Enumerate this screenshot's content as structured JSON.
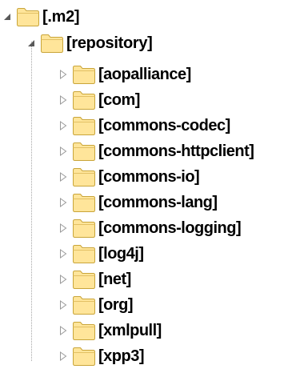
{
  "colors": {
    "folder_fill": "#ffe59a",
    "folder_stroke": "#c9a53a",
    "expanded_arrow": "#595959",
    "collapsed_arrow": "#9a9a9a"
  },
  "tree": {
    "root": {
      "label": "[.m2]",
      "icon": "folder-icon",
      "expanded": true
    },
    "repository": {
      "label": "[repository]",
      "icon": "folder-icon",
      "expanded": true
    },
    "children": [
      {
        "label": "[aopalliance]",
        "expanded": false
      },
      {
        "label": "[com]",
        "expanded": false
      },
      {
        "label": "[commons-codec]",
        "expanded": false
      },
      {
        "label": "[commons-httpclient]",
        "expanded": false
      },
      {
        "label": "[commons-io]",
        "expanded": false
      },
      {
        "label": "[commons-lang]",
        "expanded": false
      },
      {
        "label": "[commons-logging]",
        "expanded": false
      },
      {
        "label": "[log4j]",
        "expanded": false
      },
      {
        "label": "[net]",
        "expanded": false
      },
      {
        "label": "[org]",
        "expanded": false
      },
      {
        "label": "[xmlpull]",
        "expanded": false
      },
      {
        "label": "[xpp3]",
        "expanded": false
      }
    ]
  }
}
